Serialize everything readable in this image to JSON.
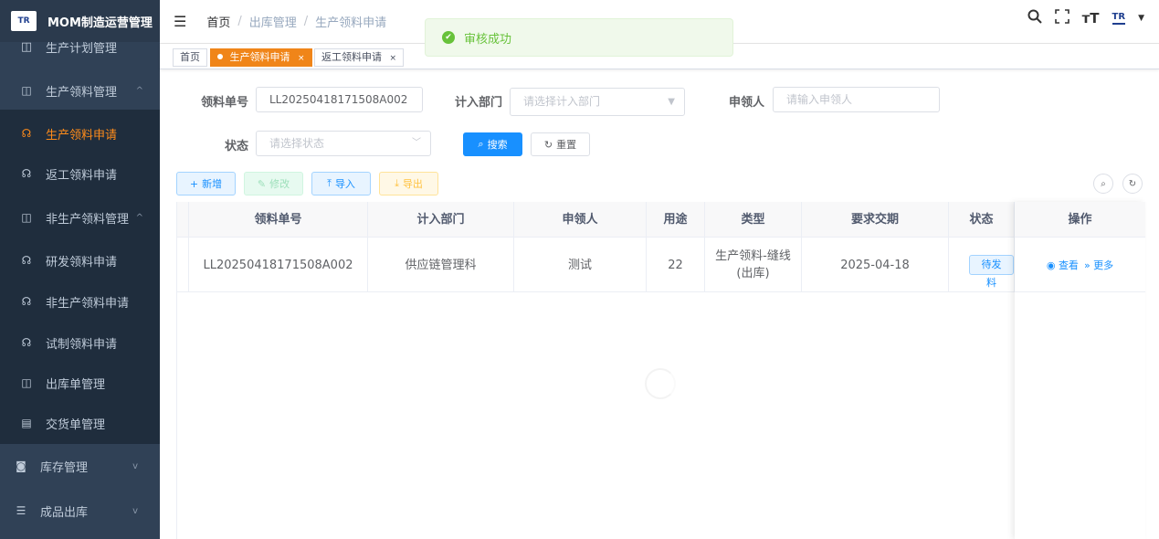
{
  "sidebar": {
    "app_title": "MOM制造运营管理",
    "logo_text": "TR",
    "items": [
      {
        "label": "生产计划管理",
        "icon": "book-icon"
      },
      {
        "label": "生产领料管理",
        "icon": "book-icon",
        "arrow": "^"
      },
      {
        "label": "生产领料申请",
        "icon": "headset-icon",
        "active": true
      },
      {
        "label": "返工领料申请",
        "icon": "headset-icon"
      },
      {
        "label": "非生产领料管理",
        "icon": "book-icon",
        "arrow": "^"
      },
      {
        "label": "研发领料申请",
        "icon": "headset-icon"
      },
      {
        "label": "非生产领料申请",
        "icon": "headset-icon"
      },
      {
        "label": "试制领料申请",
        "icon": "headset-icon"
      },
      {
        "label": "出库单管理",
        "icon": "book-icon"
      },
      {
        "label": "交货单管理",
        "icon": "calendar-icon"
      },
      {
        "label": "库存管理",
        "icon": "monitor-icon",
        "arrow": "v"
      },
      {
        "label": "成品出库",
        "icon": "list-icon",
        "arrow": "v"
      }
    ]
  },
  "header": {
    "breadcrumb": [
      "首页",
      "出库管理",
      "生产领料申请"
    ],
    "logo_text": "TR"
  },
  "tags": [
    {
      "label": "首页"
    },
    {
      "label": "生产领料申请",
      "active": true,
      "close": "×"
    },
    {
      "label": "返工领料申请",
      "close": "×"
    }
  ],
  "toast": {
    "message": "审核成功"
  },
  "form": {
    "order_no_label": "领料单号",
    "order_no_value": "LL20250418171508A002",
    "dept_label": "计入部门",
    "dept_placeholder": "请选择计入部门",
    "applicant_label": "申领人",
    "applicant_placeholder": "请输入申领人",
    "status_label": "状态",
    "status_placeholder": "请选择状态",
    "search_label": "搜索",
    "reset_label": "重置"
  },
  "toolbar": {
    "add_label": "新增",
    "edit_label": "修改",
    "import_label": "导入",
    "export_label": "导出"
  },
  "table": {
    "columns": [
      "领料单号",
      "计入部门",
      "申领人",
      "用途",
      "类型",
      "要求交期",
      "状态",
      "操作"
    ],
    "rows": [
      {
        "order_no": "LL20250418171508A002",
        "dept": "供应链管理科",
        "applicant": "测试",
        "purpose": "22",
        "type_line1": "生产领料-缝线",
        "type_line2": "(出库)",
        "due_date": "2025-04-18",
        "status": "待发料",
        "view": "查看",
        "more": "更多"
      }
    ]
  },
  "colors": {
    "sidebar_bg": "#304156",
    "accent": "#f08519",
    "primary": "#1890ff",
    "success": "#67c23a"
  }
}
